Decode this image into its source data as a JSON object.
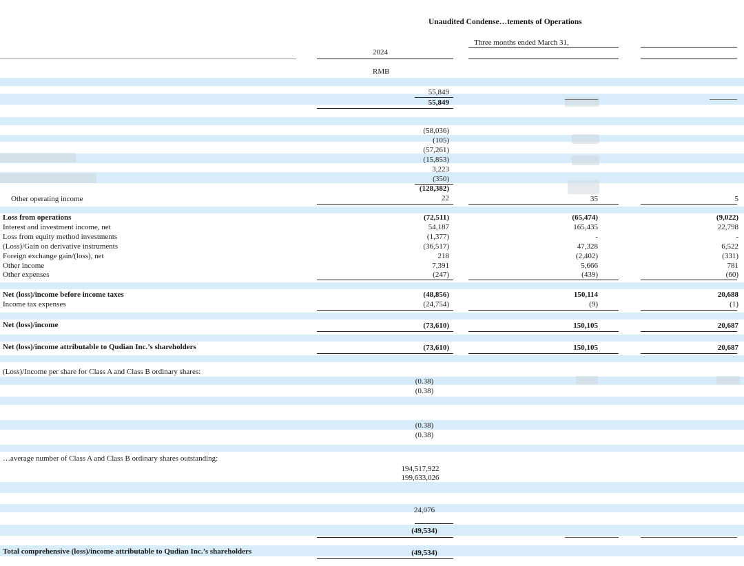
{
  "header": {
    "title": "Unaudited Condense…tements of Operations",
    "period": "Three months ended March 31,",
    "year": "2024",
    "currency": "RMB"
  },
  "rows": [
    {
      "label": "",
      "c1": "55,849",
      "c2": "",
      "c3": ""
    },
    {
      "label": "",
      "c1": "55,849",
      "c2": "",
      "c3": ""
    },
    {
      "label": "",
      "c1": "(58,036)",
      "c2": "",
      "c3": ""
    },
    {
      "label": "",
      "c1": "(105)",
      "c2": "",
      "c3": ""
    },
    {
      "label": "",
      "c1": "(57,261)",
      "c2": "",
      "c3": ""
    },
    {
      "label": "",
      "c1": "(15,853)",
      "c2": "",
      "c3": ""
    },
    {
      "label": "",
      "c1": "3,223",
      "c2": "",
      "c3": ""
    },
    {
      "label": "",
      "c1": "(350)",
      "c2": "",
      "c3": ""
    },
    {
      "label": "",
      "c1": "(128,382)",
      "c2": "",
      "c3": ""
    },
    {
      "label": "Other operating income",
      "c1": "22",
      "c2": "35",
      "c3": "5"
    },
    {
      "label": "Loss from operations",
      "c1": "(72,511)",
      "c2": "(65,474)",
      "c3": "(9,022)"
    },
    {
      "label": "Interest and investment income, net",
      "c1": "54,187",
      "c2": "165,435",
      "c3": "22,798"
    },
    {
      "label": "Loss from equity method investments",
      "c1": "(1,377)",
      "c2": "-",
      "c3": "-"
    },
    {
      "label": "(Loss)/Gain on derivative instruments",
      "c1": "(36,517)",
      "c2": "47,328",
      "c3": "6,522"
    },
    {
      "label": "Foreign exchange gain/(loss), net",
      "c1": "218",
      "c2": "(2,402)",
      "c3": "(331)"
    },
    {
      "label": "Other income",
      "c1": "7,391",
      "c2": "5,666",
      "c3": "781"
    },
    {
      "label": "Other expenses",
      "c1": "(247)",
      "c2": "(439)",
      "c3": "(60)"
    },
    {
      "label": "Net (loss)/income before income taxes",
      "c1": "(48,856)",
      "c2": "150,114",
      "c3": "20,688"
    },
    {
      "label": "Income tax expenses",
      "c1": "(24,754)",
      "c2": "(9)",
      "c3": "(1)"
    },
    {
      "label": "Net (loss)/income",
      "c1": "(73,610)",
      "c2": "150,105",
      "c3": "20,687"
    },
    {
      "label": "Net (loss)/income attributable to Qudian Inc.’s shareholders",
      "c1": "(73,610)",
      "c2": "150,105",
      "c3": "20,687"
    },
    {
      "label": "(Loss)/Income per share for Class A and Class B ordinary shares:",
      "c1": "",
      "c2": "",
      "c3": ""
    },
    {
      "label": "",
      "c1": "(0.38)",
      "c2": "",
      "c3": ""
    },
    {
      "label": "",
      "c1": "(0.38)",
      "c2": "",
      "c3": ""
    },
    {
      "label": "",
      "c1": "(0.38)",
      "c2": "",
      "c3": ""
    },
    {
      "label": "",
      "c1": "(0.38)",
      "c2": "",
      "c3": ""
    },
    {
      "label": "…average number of Class A and Class B ordinary shares outstanding:",
      "c1": "",
      "c2": "",
      "c3": ""
    },
    {
      "label": "",
      "c1": "194,517,922",
      "c2": "",
      "c3": ""
    },
    {
      "label": "",
      "c1": "199,633,026",
      "c2": "",
      "c3": ""
    },
    {
      "label": "",
      "c1": "24,076",
      "c2": "",
      "c3": ""
    },
    {
      "label": "",
      "c1": "(49,534)",
      "c2": "",
      "c3": ""
    },
    {
      "label": "Total comprehensive (loss)/income attributable to Qudian Inc.’s shareholders",
      "c1": "(49,534)",
      "c2": "",
      "c3": ""
    }
  ]
}
